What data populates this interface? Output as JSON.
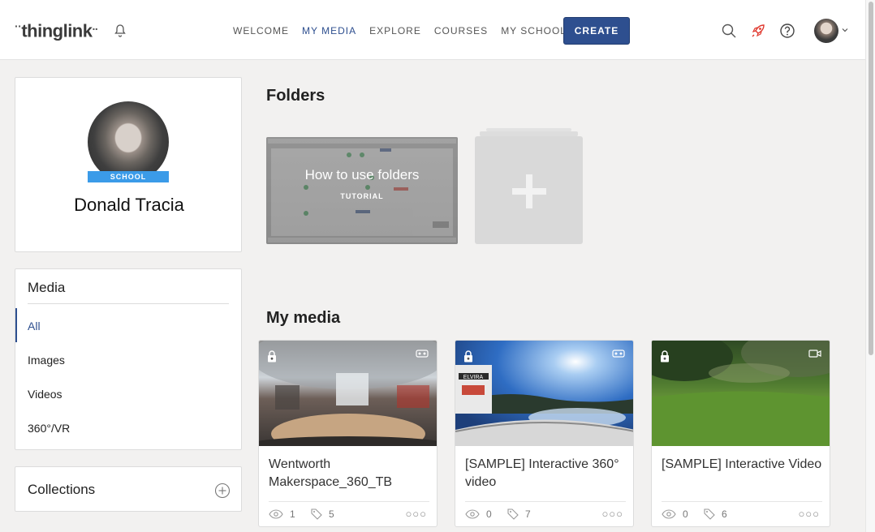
{
  "header": {
    "logo": "thinglink",
    "nav": [
      {
        "label": "WELCOME",
        "active": false
      },
      {
        "label": "MY MEDIA",
        "active": true
      },
      {
        "label": "EXPLORE",
        "active": false
      },
      {
        "label": "COURSES",
        "active": false
      },
      {
        "label": "MY SCHOOL",
        "active": false
      }
    ],
    "create_label": "CREATE",
    "icons": [
      "bell-icon",
      "search-icon",
      "rocket-icon",
      "help-icon",
      "avatar",
      "chevron-down-icon"
    ]
  },
  "profile": {
    "name": "Donald Tracia",
    "badge": "SCHOOL"
  },
  "media_menu": {
    "title": "Media",
    "items": [
      {
        "label": "All",
        "active": true
      },
      {
        "label": "Images",
        "active": false
      },
      {
        "label": "Videos",
        "active": false
      },
      {
        "label": "360°/VR",
        "active": false
      }
    ]
  },
  "collections": {
    "title": "Collections"
  },
  "folders": {
    "title": "Folders",
    "tutorial": {
      "title": "How to use folders",
      "subtitle": "TUTORIAL"
    }
  },
  "my_media": {
    "title": "My media",
    "tiles": [
      {
        "title": "Wentworth Makerspace_360_TB",
        "views": "1",
        "tags": "5",
        "type_icon": "vr-icon"
      },
      {
        "title": "[SAMPLE] Interactive 360° video",
        "views": "0",
        "tags": "7",
        "type_icon": "vr-icon"
      },
      {
        "title": "[SAMPLE] Interactive Video",
        "views": "0",
        "tags": "6",
        "type_icon": "video-camera-icon"
      }
    ]
  },
  "colors": {
    "accent": "#2e4f8f",
    "badge": "#3b9be8",
    "background": "#f2f1f0"
  }
}
